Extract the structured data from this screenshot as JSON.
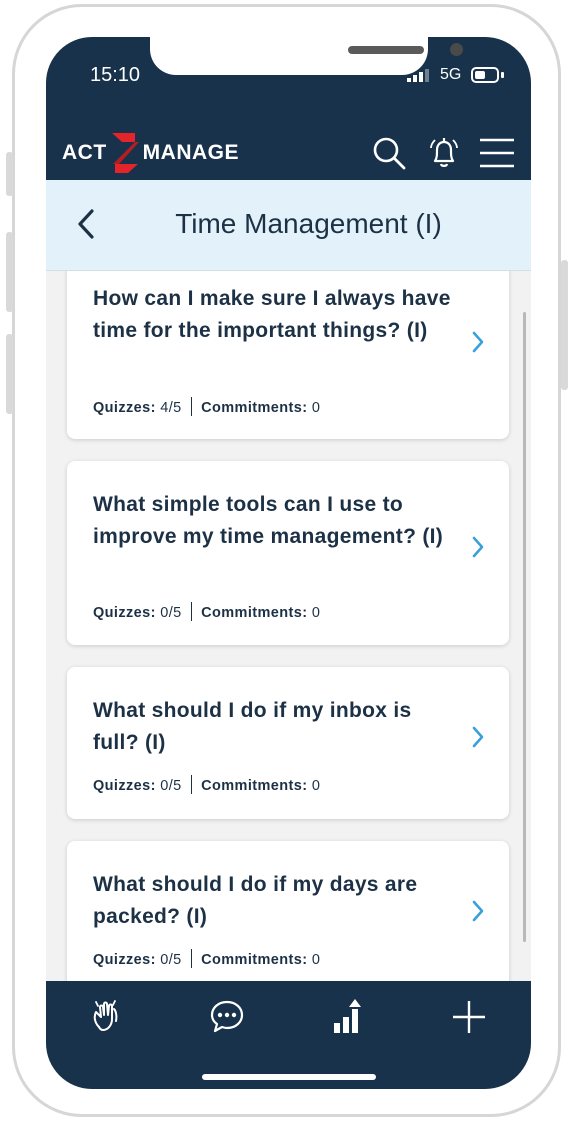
{
  "status_bar": {
    "time": "15:10",
    "network": "5G"
  },
  "header": {
    "logo_left": "ACT",
    "logo_right": "MANAGE",
    "icons": [
      "search-icon",
      "bell-icon",
      "menu-icon"
    ]
  },
  "page": {
    "title": "Time Management (I)"
  },
  "cards": [
    {
      "question": "How can I make sure I always have time for the important things? (I)",
      "quizzes_label": "Quizzes:",
      "quizzes": "4/5",
      "commitments_label": "Commitments:",
      "commitments": "0"
    },
    {
      "question": "What simple tools can I use to improve my time management? (I)",
      "quizzes_label": "Quizzes:",
      "quizzes": "0/5",
      "commitments_label": "Commitments:",
      "commitments": "0"
    },
    {
      "question": "What should I do if my inbox is full? (I)",
      "quizzes_label": "Quizzes:",
      "quizzes": "0/5",
      "commitments_label": "Commitments:",
      "commitments": "0"
    },
    {
      "question": "What should I do if my days are packed? (I)",
      "quizzes_label": "Quizzes:",
      "quizzes": "0/5",
      "commitments_label": "Commitments:",
      "commitments": "0"
    }
  ],
  "tab_bar": {
    "icons": [
      "clap-hands-icon",
      "chat-bubble-icon",
      "bar-chart-icon",
      "plus-icon"
    ]
  },
  "colors": {
    "navy": "#17324a",
    "title_bg": "#e3f2fa",
    "chevron": "#3aa0dc",
    "logo_red": "#e3242b"
  }
}
